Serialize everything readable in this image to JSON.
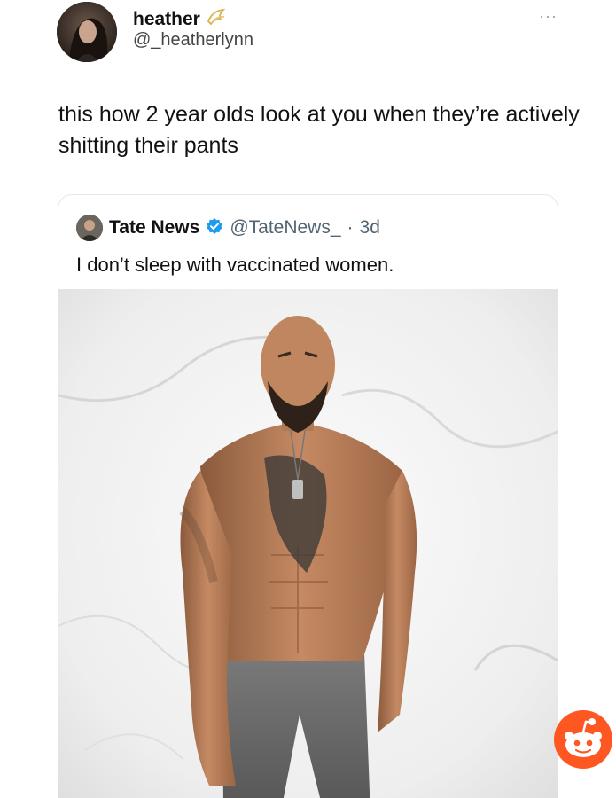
{
  "author": {
    "display_name": "heather",
    "handle": "@_heatherlynn",
    "badge_icon": "gold-ribbon-icon"
  },
  "tweet": {
    "text": "this how 2 year olds look at you when they’re actively shitting their pants"
  },
  "more_menu": {
    "label": "···"
  },
  "quote": {
    "display_name": "Tate News",
    "handle": "@TateNews_",
    "separator": "·",
    "timestamp": "3d",
    "verified_icon": "verified-badge-icon",
    "verified_color": "#1d9bf0",
    "text": "I don’t sleep with vaccinated women."
  },
  "colors": {
    "reddit_orange": "#ff5722",
    "background": "#ffffff"
  }
}
